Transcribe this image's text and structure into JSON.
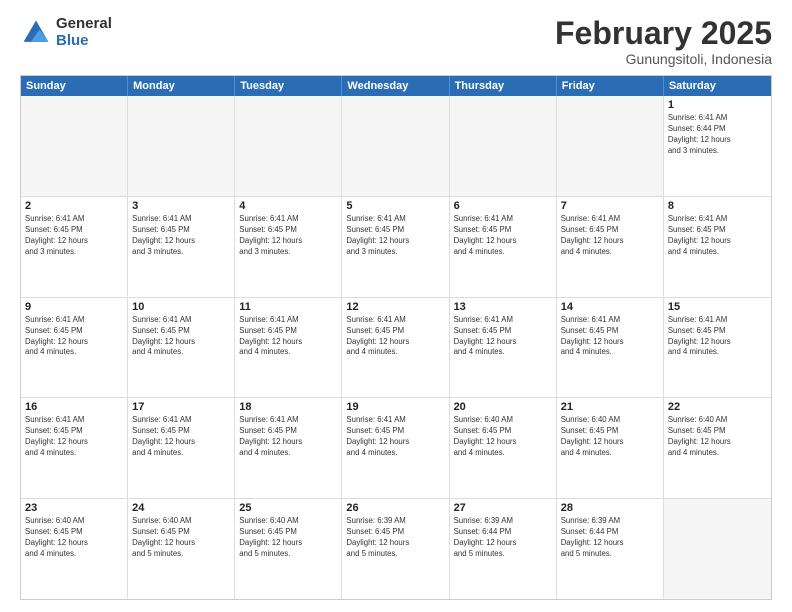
{
  "logo": {
    "general": "General",
    "blue": "Blue"
  },
  "title": "February 2025",
  "subtitle": "Gunungsitoli, Indonesia",
  "header_days": [
    "Sunday",
    "Monday",
    "Tuesday",
    "Wednesday",
    "Thursday",
    "Friday",
    "Saturday"
  ],
  "weeks": [
    [
      {
        "day": "",
        "info": "",
        "empty": true
      },
      {
        "day": "",
        "info": "",
        "empty": true
      },
      {
        "day": "",
        "info": "",
        "empty": true
      },
      {
        "day": "",
        "info": "",
        "empty": true
      },
      {
        "day": "",
        "info": "",
        "empty": true
      },
      {
        "day": "",
        "info": "",
        "empty": true
      },
      {
        "day": "1",
        "info": "Sunrise: 6:41 AM\nSunset: 6:44 PM\nDaylight: 12 hours\nand 3 minutes.",
        "empty": false
      }
    ],
    [
      {
        "day": "2",
        "info": "Sunrise: 6:41 AM\nSunset: 6:45 PM\nDaylight: 12 hours\nand 3 minutes.",
        "empty": false
      },
      {
        "day": "3",
        "info": "Sunrise: 6:41 AM\nSunset: 6:45 PM\nDaylight: 12 hours\nand 3 minutes.",
        "empty": false
      },
      {
        "day": "4",
        "info": "Sunrise: 6:41 AM\nSunset: 6:45 PM\nDaylight: 12 hours\nand 3 minutes.",
        "empty": false
      },
      {
        "day": "5",
        "info": "Sunrise: 6:41 AM\nSunset: 6:45 PM\nDaylight: 12 hours\nand 3 minutes.",
        "empty": false
      },
      {
        "day": "6",
        "info": "Sunrise: 6:41 AM\nSunset: 6:45 PM\nDaylight: 12 hours\nand 4 minutes.",
        "empty": false
      },
      {
        "day": "7",
        "info": "Sunrise: 6:41 AM\nSunset: 6:45 PM\nDaylight: 12 hours\nand 4 minutes.",
        "empty": false
      },
      {
        "day": "8",
        "info": "Sunrise: 6:41 AM\nSunset: 6:45 PM\nDaylight: 12 hours\nand 4 minutes.",
        "empty": false
      }
    ],
    [
      {
        "day": "9",
        "info": "Sunrise: 6:41 AM\nSunset: 6:45 PM\nDaylight: 12 hours\nand 4 minutes.",
        "empty": false
      },
      {
        "day": "10",
        "info": "Sunrise: 6:41 AM\nSunset: 6:45 PM\nDaylight: 12 hours\nand 4 minutes.",
        "empty": false
      },
      {
        "day": "11",
        "info": "Sunrise: 6:41 AM\nSunset: 6:45 PM\nDaylight: 12 hours\nand 4 minutes.",
        "empty": false
      },
      {
        "day": "12",
        "info": "Sunrise: 6:41 AM\nSunset: 6:45 PM\nDaylight: 12 hours\nand 4 minutes.",
        "empty": false
      },
      {
        "day": "13",
        "info": "Sunrise: 6:41 AM\nSunset: 6:45 PM\nDaylight: 12 hours\nand 4 minutes.",
        "empty": false
      },
      {
        "day": "14",
        "info": "Sunrise: 6:41 AM\nSunset: 6:45 PM\nDaylight: 12 hours\nand 4 minutes.",
        "empty": false
      },
      {
        "day": "15",
        "info": "Sunrise: 6:41 AM\nSunset: 6:45 PM\nDaylight: 12 hours\nand 4 minutes.",
        "empty": false
      }
    ],
    [
      {
        "day": "16",
        "info": "Sunrise: 6:41 AM\nSunset: 6:45 PM\nDaylight: 12 hours\nand 4 minutes.",
        "empty": false
      },
      {
        "day": "17",
        "info": "Sunrise: 6:41 AM\nSunset: 6:45 PM\nDaylight: 12 hours\nand 4 minutes.",
        "empty": false
      },
      {
        "day": "18",
        "info": "Sunrise: 6:41 AM\nSunset: 6:45 PM\nDaylight: 12 hours\nand 4 minutes.",
        "empty": false
      },
      {
        "day": "19",
        "info": "Sunrise: 6:41 AM\nSunset: 6:45 PM\nDaylight: 12 hours\nand 4 minutes.",
        "empty": false
      },
      {
        "day": "20",
        "info": "Sunrise: 6:40 AM\nSunset: 6:45 PM\nDaylight: 12 hours\nand 4 minutes.",
        "empty": false
      },
      {
        "day": "21",
        "info": "Sunrise: 6:40 AM\nSunset: 6:45 PM\nDaylight: 12 hours\nand 4 minutes.",
        "empty": false
      },
      {
        "day": "22",
        "info": "Sunrise: 6:40 AM\nSunset: 6:45 PM\nDaylight: 12 hours\nand 4 minutes.",
        "empty": false
      }
    ],
    [
      {
        "day": "23",
        "info": "Sunrise: 6:40 AM\nSunset: 6:45 PM\nDaylight: 12 hours\nand 4 minutes.",
        "empty": false
      },
      {
        "day": "24",
        "info": "Sunrise: 6:40 AM\nSunset: 6:45 PM\nDaylight: 12 hours\nand 5 minutes.",
        "empty": false
      },
      {
        "day": "25",
        "info": "Sunrise: 6:40 AM\nSunset: 6:45 PM\nDaylight: 12 hours\nand 5 minutes.",
        "empty": false
      },
      {
        "day": "26",
        "info": "Sunrise: 6:39 AM\nSunset: 6:45 PM\nDaylight: 12 hours\nand 5 minutes.",
        "empty": false
      },
      {
        "day": "27",
        "info": "Sunrise: 6:39 AM\nSunset: 6:44 PM\nDaylight: 12 hours\nand 5 minutes.",
        "empty": false
      },
      {
        "day": "28",
        "info": "Sunrise: 6:39 AM\nSunset: 6:44 PM\nDaylight: 12 hours\nand 5 minutes.",
        "empty": false
      },
      {
        "day": "",
        "info": "",
        "empty": true
      }
    ]
  ]
}
